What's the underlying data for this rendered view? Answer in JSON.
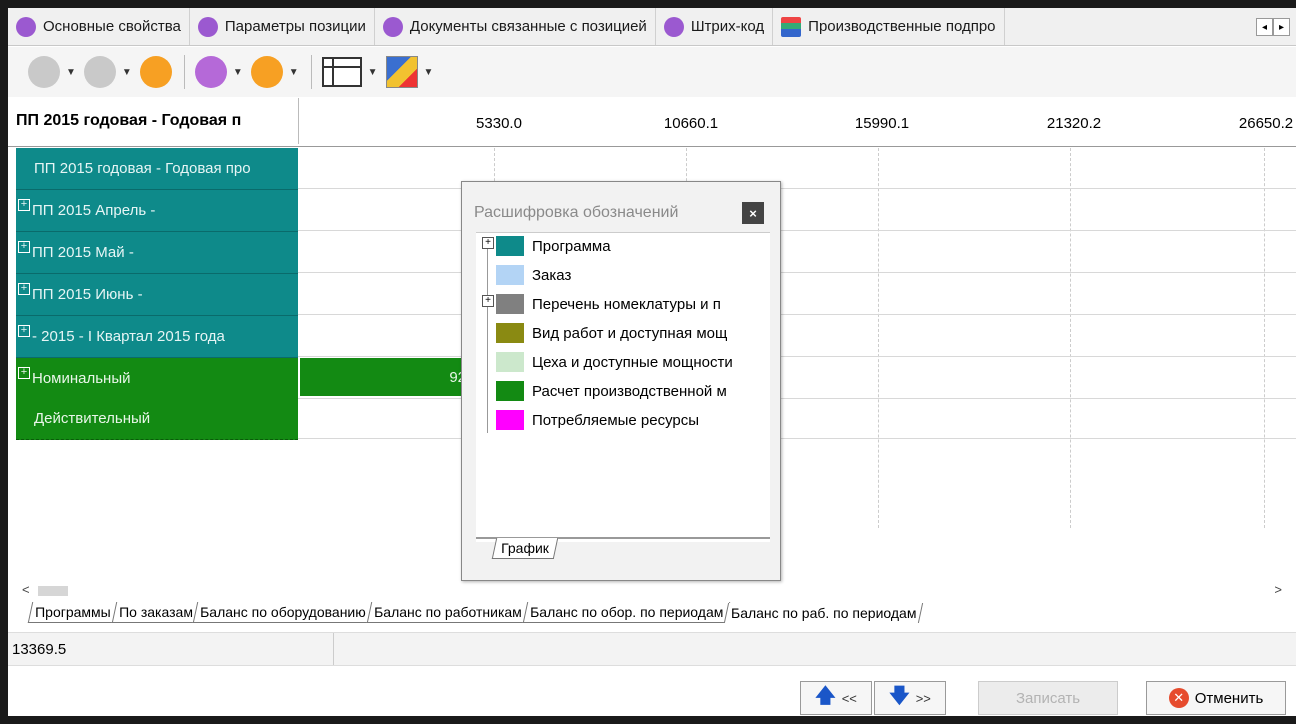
{
  "top_tabs": [
    {
      "label": "Основные свойства",
      "icon": "circle-purple-icon"
    },
    {
      "label": "Параметры позиции",
      "icon": "compass-icon"
    },
    {
      "label": "Документы связанные с позицией",
      "icon": "document-icon"
    },
    {
      "label": "Штрих-код",
      "icon": "barcode-icon"
    },
    {
      "label": "Производственные подпро",
      "icon": "grid-report-icon"
    }
  ],
  "chart": {
    "header_title": "ПП 2015 годовая - Годовая п",
    "ticks": [
      "5330.0",
      "10660.1",
      "15990.1",
      "21320.2",
      "26650.2"
    ],
    "rows": [
      {
        "label": "ПП 2015 годовая - Годовая про",
        "expandable": false
      },
      {
        "label": "ПП 2015 Апрель -",
        "expandable": true
      },
      {
        "label": "ПП 2015 Май -",
        "expandable": true
      },
      {
        "label": "ПП 2015 Июнь -",
        "expandable": true
      },
      {
        "label": " - 2015 - I Квартал 2015 года",
        "expandable": true
      },
      {
        "label": "Номинальный",
        "expandable": true
      },
      {
        "label": "Действительный",
        "expandable": false
      }
    ],
    "bar_value_label": "92"
  },
  "legend": {
    "title": "Расшифровка обозначений",
    "items": [
      {
        "label": "Программа",
        "color": "#0e8a8a",
        "expandable": true
      },
      {
        "label": "Заказ",
        "color": "#b3d4f5",
        "expandable": false
      },
      {
        "label": "Перечень номеклатуры и п",
        "color": "#808080",
        "expandable": true
      },
      {
        "label": "Вид работ и доступная мощ",
        "color": "#8a8a12",
        "expandable": false
      },
      {
        "label": "Цеха и доступные мощности",
        "color": "#cce8cc",
        "expandable": false
      },
      {
        "label": "Расчет производственной м",
        "color": "#138a13",
        "expandable": false
      },
      {
        "label": "Потребляемые ресурсы",
        "color": "#ff00ff",
        "expandable": false
      }
    ],
    "tab_label": "График"
  },
  "bottom_tabs": [
    "Программы",
    "По заказам",
    "Баланс по оборудованию",
    "Баланс по работникам",
    "Баланс по обор. по периодам",
    "Баланс по раб. по периодам"
  ],
  "active_bottom_tab": "Баланс по раб. по периодам",
  "status": {
    "value": "13369.5"
  },
  "buttons": {
    "prev_label": "<<",
    "next_label": ">>",
    "save_label": "Записать",
    "cancel_label": "Отменить"
  }
}
